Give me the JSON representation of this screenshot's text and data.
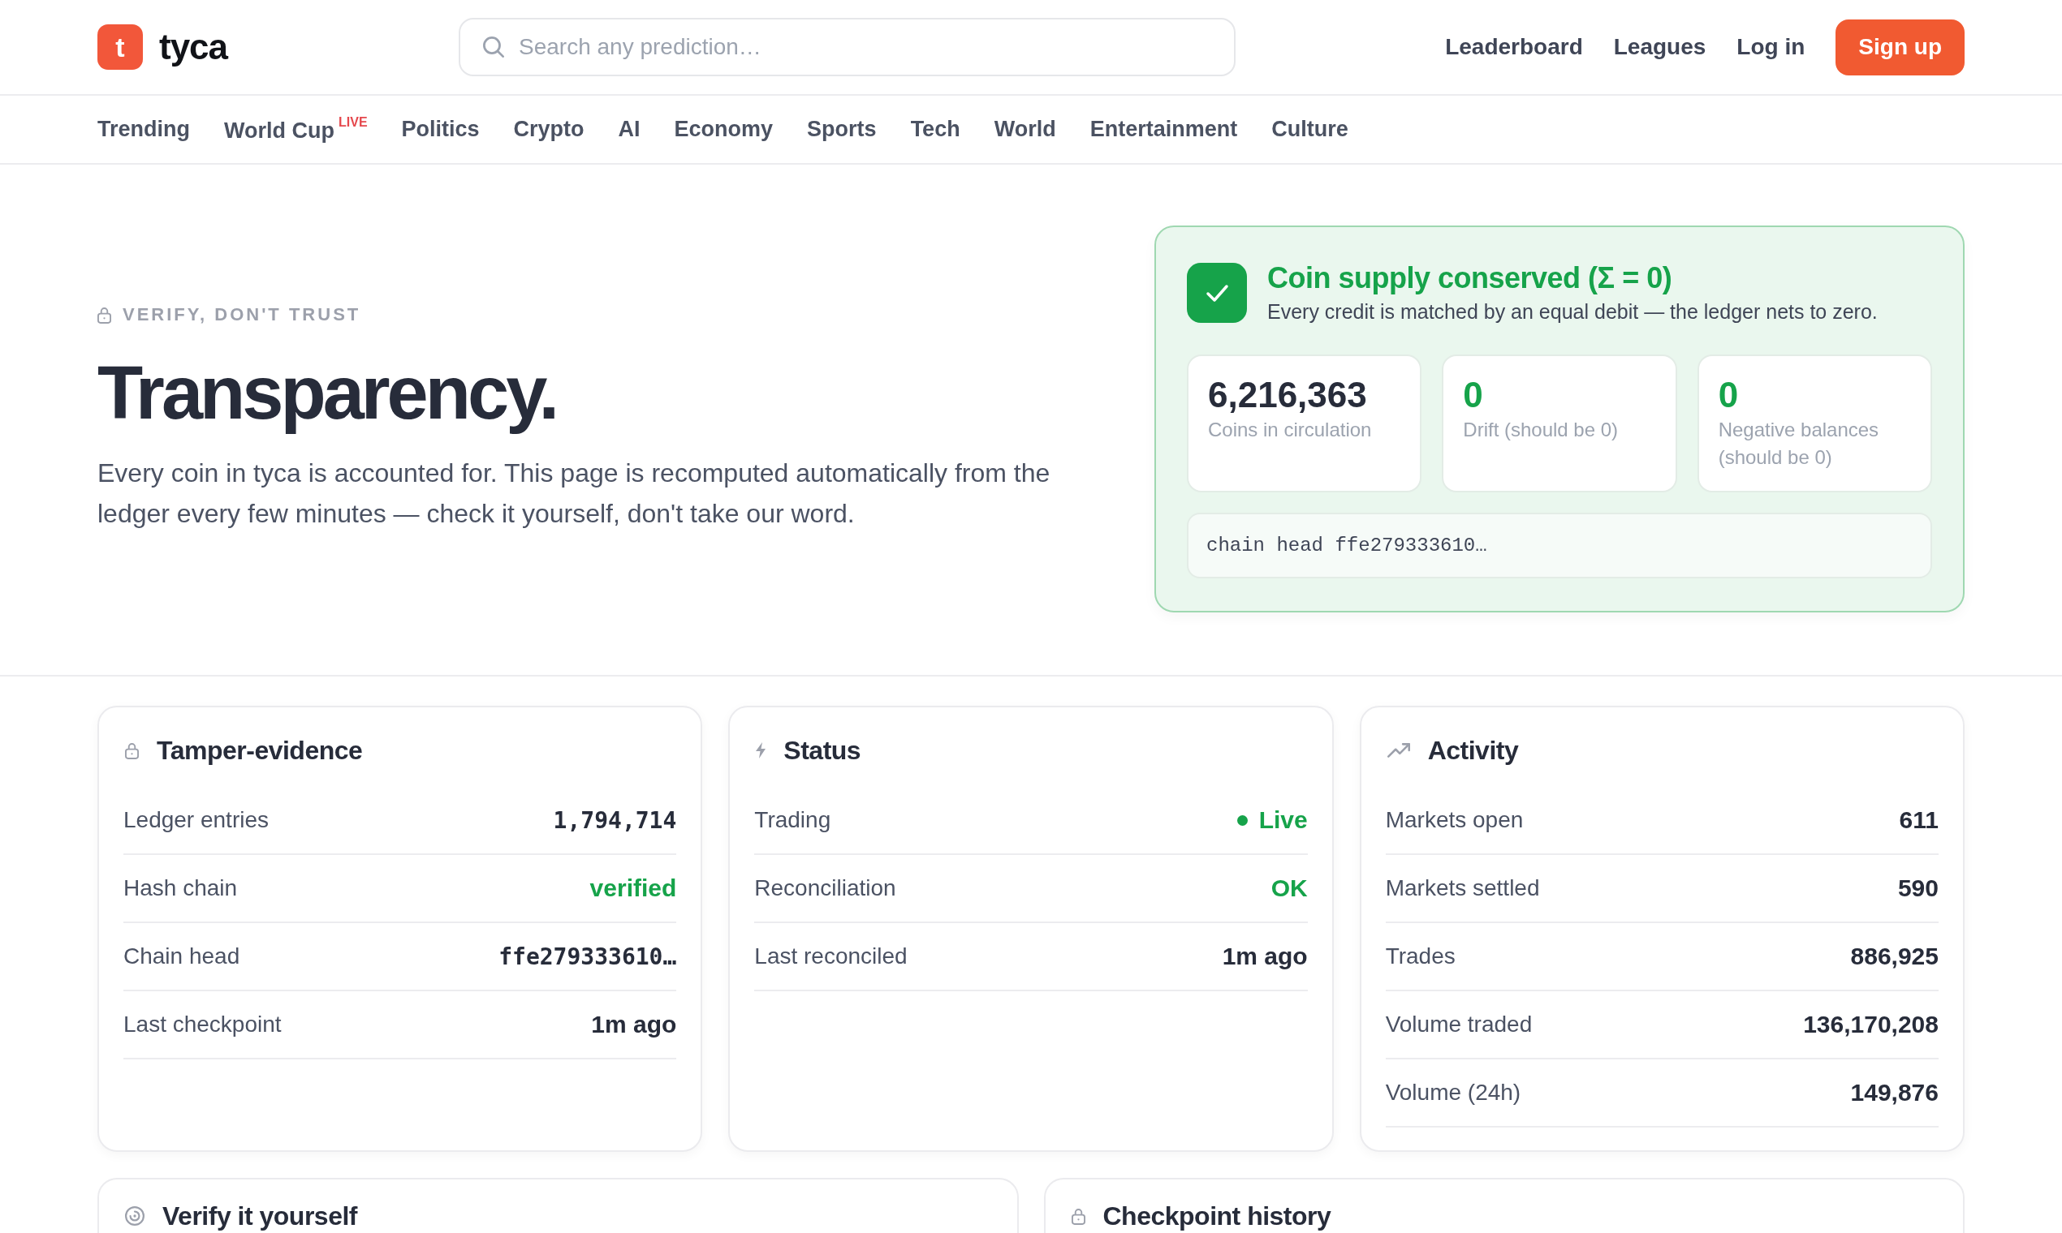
{
  "header": {
    "logo": {
      "mark": "t",
      "name": "tyca"
    },
    "search": {
      "placeholder": "Search any prediction…"
    },
    "links": [
      "Leaderboard",
      "Leagues",
      "Log in"
    ],
    "signup": "Sign up"
  },
  "categories": [
    {
      "label": "Trending"
    },
    {
      "label": "World Cup",
      "badge": "LIVE"
    },
    {
      "label": "Politics"
    },
    {
      "label": "Crypto"
    },
    {
      "label": "AI"
    },
    {
      "label": "Economy"
    },
    {
      "label": "Sports"
    },
    {
      "label": "Tech"
    },
    {
      "label": "World"
    },
    {
      "label": "Entertainment"
    },
    {
      "label": "Culture"
    }
  ],
  "hero": {
    "eyebrow": "VERIFY, DON'T TRUST",
    "title": "Transparency.",
    "description": "Every coin in tyca is accounted for. This page is recomputed automatically from the ledger every few minutes — check it yourself, don't take our word."
  },
  "conservation": {
    "passed": true,
    "title": "Coin supply conserved (Σ = 0)",
    "subtitle": "Every credit is matched by an equal debit — the ledger nets to zero.",
    "stats": [
      {
        "kind": "total",
        "value": "6,216,363",
        "label": "Coins in circulation"
      },
      {
        "kind": "check",
        "value": "0",
        "label": "Drift (should be 0)"
      },
      {
        "kind": "check",
        "value": "0",
        "label": "Negative balances (should be 0)"
      }
    ],
    "chain_head": "chain head ffe279333610…"
  },
  "panels": [
    {
      "title": "Tamper-evidence",
      "rows": [
        {
          "label": "Ledger entries",
          "value": "1,794,714",
          "kind": "mono"
        },
        {
          "label": "Hash chain",
          "value": "verified",
          "kind": "good"
        },
        {
          "label": "Chain head",
          "value": "ffe279333610…",
          "kind": "mono"
        },
        {
          "label": "Last checkpoint",
          "value": "1m ago",
          "kind": "plain"
        }
      ]
    },
    {
      "title": "Status",
      "rows": [
        {
          "label": "Trading",
          "value": "Live",
          "kind": "live"
        },
        {
          "label": "Reconciliation",
          "value": "OK",
          "kind": "good"
        },
        {
          "label": "Last reconciled",
          "value": "1m ago",
          "kind": "plain"
        }
      ]
    },
    {
      "title": "Activity",
      "rows": [
        {
          "label": "Markets open",
          "value": "611",
          "kind": "plain"
        },
        {
          "label": "Markets settled",
          "value": "590",
          "kind": "plain"
        },
        {
          "label": "Trades",
          "value": "886,925",
          "kind": "plain"
        },
        {
          "label": "Volume traded",
          "value": "136,170,208",
          "kind": "plain"
        },
        {
          "label": "Volume (24h)",
          "value": "149,876",
          "kind": "plain"
        }
      ]
    }
  ],
  "sections": [
    {
      "title": "Verify it yourself"
    },
    {
      "title": "Checkpoint history"
    }
  ]
}
